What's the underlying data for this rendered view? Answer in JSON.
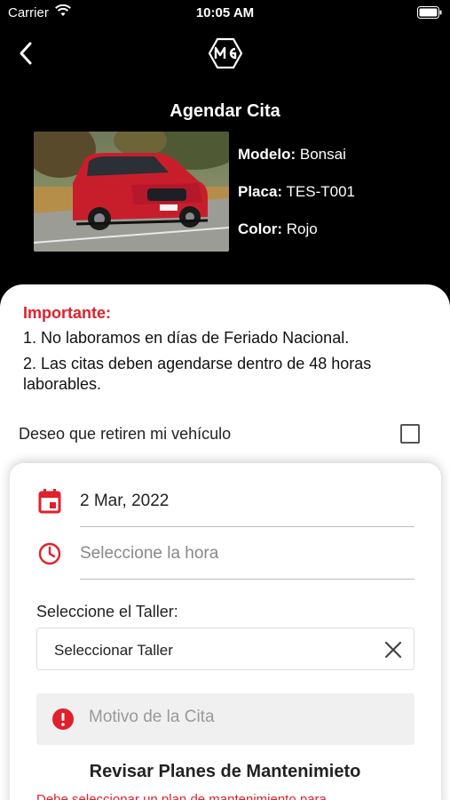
{
  "status_bar": {
    "carrier": "Carrier",
    "time": "10:05 AM"
  },
  "header": {
    "title": "Agendar Cita",
    "logo_text": "MG"
  },
  "vehicle": {
    "model_label": "Modelo:",
    "model_value": "Bonsai",
    "plate_label": "Placa:",
    "plate_value": "TES-T001",
    "color_label": "Color:",
    "color_value": "Rojo"
  },
  "notice": {
    "title": "Importante:",
    "items": [
      "1. No laboramos en días de Feriado Nacional.",
      "2. Las citas deben agendarse dentro de 48 horas laborables."
    ]
  },
  "pickup": {
    "label": "Deseo que retiren mi vehículo",
    "checked": false
  },
  "form": {
    "date_value": "2 Mar, 2022",
    "time_placeholder": "Seleccione la hora",
    "taller_label": "Seleccione el Taller:",
    "taller_value": "Seleccionar Taller",
    "motivo_placeholder": "Motivo de la Cita",
    "plans_title": "Revisar Planes de Mantenimieto",
    "plans_error": "Debe seleccionar un plan de mantenimiento para"
  },
  "colors": {
    "accent": "#e0202b",
    "background": "#000000"
  }
}
